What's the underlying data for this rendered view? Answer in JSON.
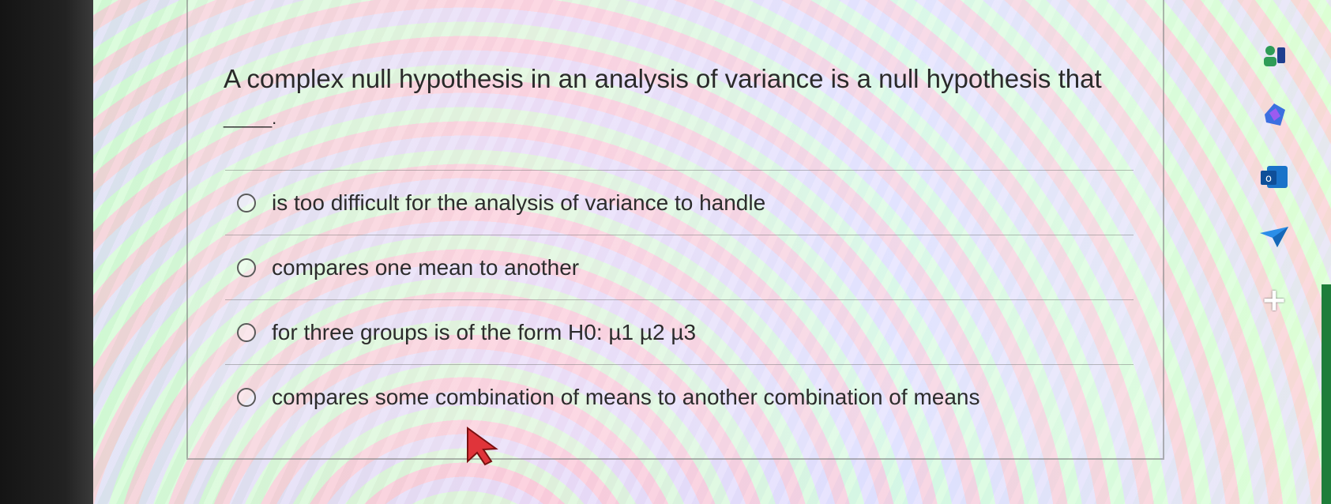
{
  "question": {
    "text": "A complex null hypothesis in an analysis of variance is a null hypothesis that",
    "blank": "_____."
  },
  "options": [
    {
      "label": "is too difficult for the analysis of variance to handle"
    },
    {
      "label": "compares one mean to another"
    },
    {
      "label": "for three groups is of the form H0: µ1 µ2 µ3"
    },
    {
      "label": "compares some combination of means to another combination of means"
    }
  ],
  "sidebar": {
    "icons": [
      "user-icon",
      "copilot-icon",
      "outlook-icon",
      "send-icon",
      "plus-icon"
    ],
    "plus_label": "+"
  },
  "colors": {
    "text": "#2a2a2a",
    "border": "#787878",
    "bezel": "#1a1a1a",
    "accent_green": "#1e7d3a"
  }
}
